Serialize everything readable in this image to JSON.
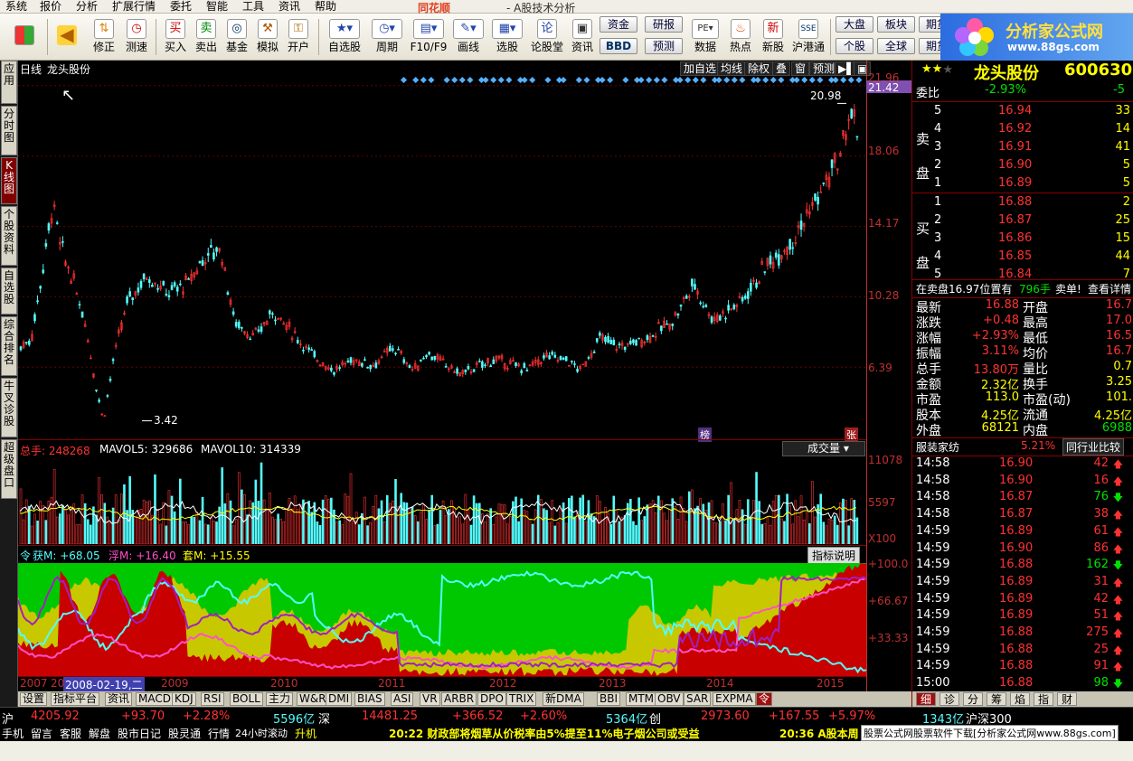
{
  "menu": {
    "items": [
      "系统",
      "报价",
      "分析",
      "扩展行情",
      "委托",
      "智能",
      "工具",
      "资讯",
      "帮助"
    ],
    "logo": "同花顺",
    "title": "- A股技术分析"
  },
  "toolbar": {
    "buttons": [
      "修正",
      "测速",
      "买入",
      "卖出",
      "基金",
      "模拟",
      "开户",
      "自选股",
      "周期",
      "F10/F9",
      "画线",
      "选股",
      "论股堂",
      "资讯",
      "数据",
      "热点",
      "新股",
      "沪港通"
    ],
    "small": {
      "zijin": "资金",
      "yanbao": "研报",
      "bbd": "BBD",
      "yuce": "预测",
      "dapan": "大盘",
      "bankuai": "板块",
      "qihuo": "期货",
      "geg": "个股",
      "quanqiu": "全球",
      "qi2": "期货"
    }
  },
  "brand": {
    "name": "分析家公式网",
    "url": "www.88gs.com"
  },
  "left_tabs": [
    "应用",
    "分时图",
    "K线图",
    "个股资料",
    "自选股",
    "综合排名",
    "牛叉诊股",
    "超级盘口"
  ],
  "chart": {
    "period": "日线",
    "stock": "龙头股份",
    "top_buttons": [
      "加自选",
      "均线",
      "除权",
      "叠",
      "窗",
      "预测"
    ],
    "price_axis": [
      "21.96",
      "21.42",
      "18.06",
      "14.17",
      "10.28",
      "6.39"
    ],
    "high_label": "20.98",
    "low_label": "3.42",
    "markers": {
      "bang": "榜",
      "zhang": "张"
    },
    "vol_header": {
      "total": "总手: 248268",
      "mavol5": "MAVOL5: 329686",
      "mavol10": "MAVOL10: 314339",
      "dropdown": "成交量"
    },
    "vol_axis": [
      "11078",
      "5597",
      "X100"
    ],
    "ind_header": {
      "ling": "令",
      "huo": "获M: +68.05",
      "fu": "浮M: +16.40",
      "tao": "套M: +15.55",
      "help": "指标说明"
    },
    "ind_axis": [
      "+100.0",
      "+66.67",
      "+33.33"
    ],
    "years": [
      "2007",
      "20",
      "2009",
      "2010",
      "2011",
      "2012",
      "2013",
      "2014",
      "2015"
    ],
    "cursor_date": "2008-02-19,二"
  },
  "bottom_tabs": [
    "设置",
    "指标平台",
    "资讯",
    "MACD",
    "KDJ",
    "RSI",
    "BOLL",
    "主力",
    "W&R",
    "DMI",
    "BIAS",
    "ASI",
    "VR",
    "ARBR",
    "DPO",
    "TRIX",
    "新DMA",
    "BBI",
    "MTM",
    "OBV",
    "SAR",
    "EXPMA",
    "令"
  ],
  "quote": {
    "name": "龙头股份",
    "code": "600630",
    "weibi_label": "委比",
    "weibi": "-2.93%",
    "weicha": "-5",
    "sell_label": "卖盘",
    "buy_label": "买盘",
    "sell": [
      {
        "n": "5",
        "p": "16.94",
        "v": "33"
      },
      {
        "n": "4",
        "p": "16.92",
        "v": "14"
      },
      {
        "n": "3",
        "p": "16.91",
        "v": "41"
      },
      {
        "n": "2",
        "p": "16.90",
        "v": "5"
      },
      {
        "n": "1",
        "p": "16.89",
        "v": "5"
      }
    ],
    "buy": [
      {
        "n": "1",
        "p": "16.88",
        "v": "2"
      },
      {
        "n": "2",
        "p": "16.87",
        "v": "25"
      },
      {
        "n": "3",
        "p": "16.86",
        "v": "15"
      },
      {
        "n": "4",
        "p": "16.85",
        "v": "44"
      },
      {
        "n": "5",
        "p": "16.84",
        "v": "7"
      }
    ],
    "notice": "在卖盘16.97位置有",
    "notice_vol": "796手",
    "notice_tail": "卖单!",
    "notice_link": "查看详情",
    "stats": [
      {
        "l1": "最新",
        "v1": "16.88",
        "l2": "开盘",
        "v2": "16.7"
      },
      {
        "l1": "涨跌",
        "v1": "+0.48",
        "l2": "最高",
        "v2": "17.0"
      },
      {
        "l1": "涨幅",
        "v1": "+2.93%",
        "l2": "最低",
        "v2": "16.5"
      },
      {
        "l1": "振幅",
        "v1": "3.11%",
        "l2": "均价",
        "v2": "16.7"
      },
      {
        "l1": "总手",
        "v1": "13.80万",
        "l2": "量比",
        "v2": "0.7"
      },
      {
        "l1": "金额",
        "v1": "2.32亿",
        "l2": "换手",
        "v2": "3.25"
      },
      {
        "l1": "市盈",
        "v1": "113.0",
        "l2": "市盈(动)",
        "v2": "101."
      },
      {
        "l1": "股本",
        "v1": "4.25亿",
        "l2": "流通",
        "v2": "4.25亿"
      },
      {
        "l1": "外盘",
        "v1": "68121",
        "l2": "内盘",
        "v2": "6988"
      }
    ],
    "industry": "服装家纺",
    "industry_pct": "5.21%",
    "industry_cmp": "同行业比较",
    "ticks": [
      {
        "t": "14:58",
        "p": "16.90",
        "v": "42",
        "d": "up"
      },
      {
        "t": "14:58",
        "p": "16.90",
        "v": "16",
        "d": "up"
      },
      {
        "t": "14:58",
        "p": "16.87",
        "v": "76",
        "d": "down"
      },
      {
        "t": "14:58",
        "p": "16.87",
        "v": "38",
        "d": "up"
      },
      {
        "t": "14:59",
        "p": "16.89",
        "v": "61",
        "d": "up"
      },
      {
        "t": "14:59",
        "p": "16.90",
        "v": "86",
        "d": "up"
      },
      {
        "t": "14:59",
        "p": "16.88",
        "v": "162",
        "d": "down"
      },
      {
        "t": "14:59",
        "p": "16.89",
        "v": "31",
        "d": "up"
      },
      {
        "t": "14:59",
        "p": "16.89",
        "v": "42",
        "d": "up"
      },
      {
        "t": "14:59",
        "p": "16.89",
        "v": "51",
        "d": "up"
      },
      {
        "t": "14:59",
        "p": "16.88",
        "v": "275",
        "d": "up"
      },
      {
        "t": "14:59",
        "p": "16.88",
        "v": "25",
        "d": "up"
      },
      {
        "t": "14:59",
        "p": "16.88",
        "v": "91",
        "d": "up"
      },
      {
        "t": "15:00",
        "p": "16.88",
        "v": "98",
        "d": "down"
      }
    ],
    "tabs": [
      "细",
      "诊",
      "分",
      "筹",
      "焰",
      "指",
      "财"
    ]
  },
  "index_bar": {
    "sh": "沪",
    "sh_v": "4205.92",
    "sh_c": "+93.70",
    "sh_p": "+2.28%",
    "sh_amt": "5596亿",
    "sz": "深",
    "sz_v": "14481.25",
    "sz_c": "+366.52",
    "sz_p": "+2.60%",
    "sz_amt": "5364亿",
    "cy": "创",
    "cy_v": "2973.60",
    "cy_c": "+167.55",
    "cy_p": "+5.97%",
    "hs_amt": "1343亿",
    "hs": "沪深300"
  },
  "status_bar": {
    "items": [
      "手机",
      "留言",
      "客服",
      "解盘",
      "股市日记",
      "股灵通",
      "行情",
      "24小时滚动"
    ],
    "news1": "升机",
    "news2": "20:22 财政部将烟草从价税率由5%提至11%电子烟公司或受益",
    "news3": "20:36 A股本周",
    "download": "股票公式网股票软件下载[分析家公式网www.88gs.com]"
  },
  "colors": {
    "up": "#ff3232",
    "down": "#54fcfc",
    "yellow": "#ffff00",
    "white": "#ffffff",
    "green": "#00c800"
  }
}
